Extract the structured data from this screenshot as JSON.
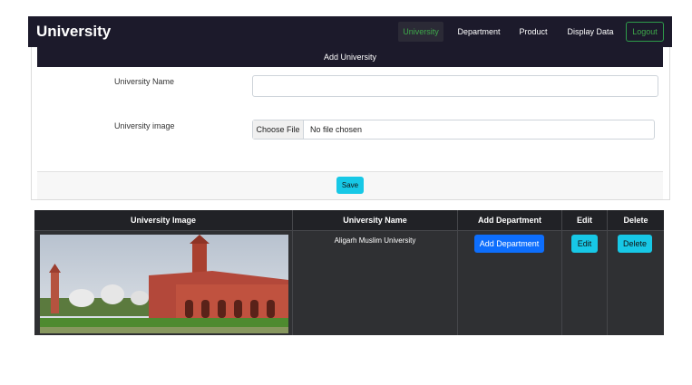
{
  "navbar": {
    "brand": "University",
    "items": [
      "University",
      "Department",
      "Product",
      "Display Data"
    ],
    "logout": "Logout",
    "colors": {
      "bg": "#1c1a2b",
      "active": "#3ea84a"
    }
  },
  "form": {
    "header": "Add University",
    "name_label": "University Name",
    "name_value": "",
    "image_label": "University image",
    "file_button": "Choose File",
    "file_status": "No file chosen",
    "save_label": "Save"
  },
  "table": {
    "headers": [
      "University Image",
      "University Name",
      "Add Department",
      "Edit",
      "Delete"
    ],
    "rows": [
      {
        "image": "university-building-photo",
        "name": "Aligarh Muslim University",
        "add_department": "Add Department",
        "edit": "Edit",
        "delete": "Delete"
      }
    ]
  }
}
